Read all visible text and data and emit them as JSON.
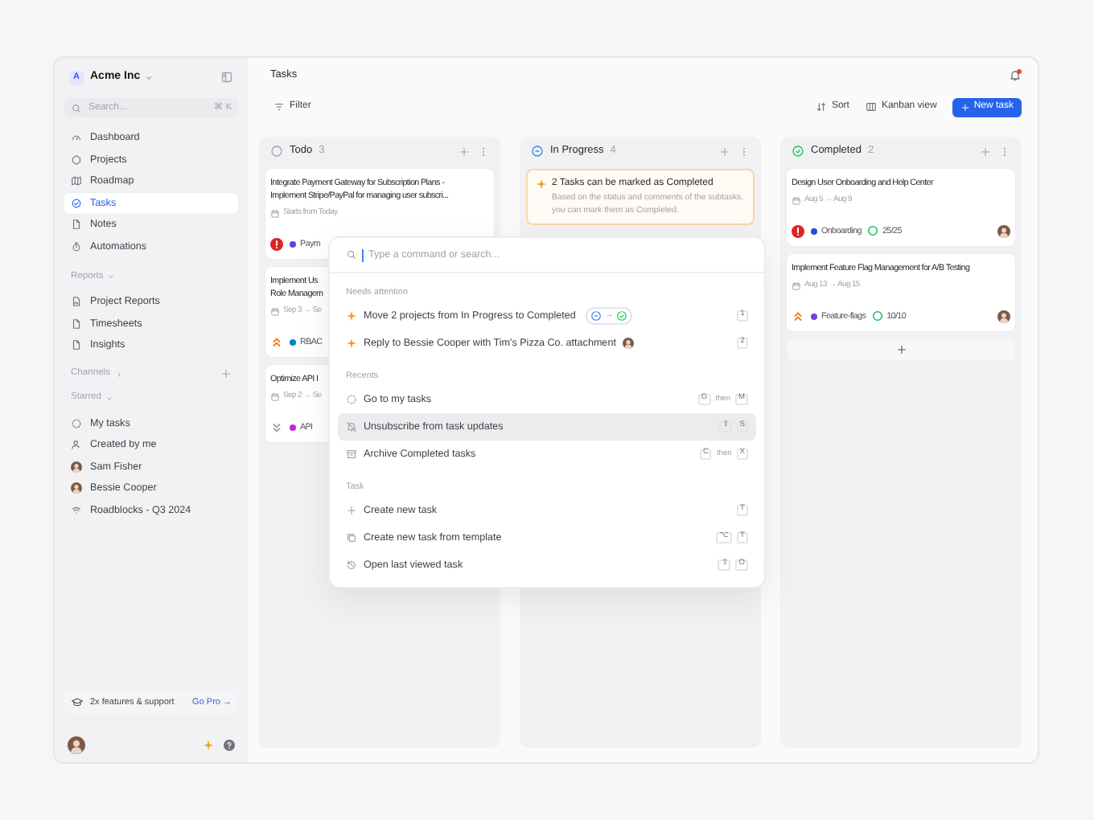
{
  "sidebar": {
    "workspace": {
      "initial": "A",
      "name": "Acme Inc"
    },
    "search": {
      "placeholder": "Search...",
      "shortcut": "⌘ K"
    },
    "nav": [
      {
        "label": "Dashboard",
        "kind": "gauge",
        "selected": false
      },
      {
        "label": "Projects",
        "kind": "hexagon",
        "selected": false
      },
      {
        "label": "Roadmap",
        "kind": "map",
        "selected": false
      },
      {
        "label": "Tasks",
        "kind": "check-circle",
        "selected": true
      },
      {
        "label": "Notes",
        "kind": "file",
        "selected": false
      },
      {
        "label": "Automations",
        "kind": "stopwatch",
        "selected": false
      }
    ],
    "sections": [
      {
        "title": "Reports",
        "expanded": true,
        "items": [
          {
            "label": "Project Reports",
            "kind": "file-chart"
          },
          {
            "label": "Timesheets",
            "kind": "file"
          },
          {
            "label": "Insights",
            "kind": "file"
          }
        ]
      },
      {
        "title": "Channels",
        "expanded": false,
        "addable": true
      },
      {
        "title": "Starred",
        "expanded": true,
        "items": [
          {
            "label": "My tasks",
            "kind": "dashed-circle"
          },
          {
            "label": "Created by me",
            "kind": "user"
          },
          {
            "label": "Sam Fisher",
            "kind": "avatar"
          },
          {
            "label": "Bessie Cooper",
            "kind": "avatar"
          },
          {
            "label": "Roadblocks - Q3 2024",
            "kind": "signal"
          }
        ]
      }
    ],
    "promo": {
      "text": "2x features & support",
      "link": "Go Pro →"
    }
  },
  "header": {
    "title": "Tasks",
    "notification_unread": true
  },
  "toolbar": {
    "filter": "Filter",
    "sort": "Sort",
    "view": "Kanban view",
    "new_task": "New task"
  },
  "columns": [
    {
      "title": "Todo",
      "kind": "todo",
      "count": "3",
      "cards": [
        {
          "title_lines": [
            "Integrate Payment Gateway for Subscription Plans -",
            "Implement Stripe/PayPal for managing user subscri..."
          ],
          "date": "Starts from Today",
          "kind": "urgent",
          "tag": {
            "label": "Paym",
            "color": "#4f46e5"
          }
        },
        {
          "title_lines": [
            "Implement Us",
            "Role Managem"
          ],
          "date": "Sep 3 → Se",
          "kind": "high",
          "tag": {
            "label": "RBAC",
            "color": "#0284c7"
          }
        },
        {
          "title_lines": [
            "Optimize API I"
          ],
          "date": "Sep 2 → Se",
          "kind": "low",
          "tag": {
            "label": "API",
            "color": "#c026d3"
          }
        }
      ]
    },
    {
      "title": "In Progress",
      "kind": "in_progress",
      "count": "4",
      "notice": {
        "title": "2 Tasks can be marked as Completed",
        "text": "Based on the status and comments of the subtasks, you can mark them as Completed."
      }
    },
    {
      "title": "Completed",
      "kind": "completed",
      "count": "2",
      "add_card": true,
      "cards": [
        {
          "title_lines": [
            "Design User Onboarding and Help Center"
          ],
          "date": "Aug 5 → Aug 9",
          "kind": "urgent",
          "tag": {
            "label": "Onboarding",
            "color": "#1d4ed8"
          },
          "progress": {
            "text": "25/25",
            "level": 1
          },
          "avatar": true
        },
        {
          "title_lines": [
            "Implement Feature Flag Management for A/B Testing"
          ],
          "date": "Aug 13 → Aug 15",
          "kind": "high",
          "tag": {
            "label": "Feature-flags",
            "color": "#7c3aed"
          },
          "progress": {
            "text": "10/10",
            "level": 1
          },
          "avatar": true
        }
      ]
    }
  ],
  "palette": {
    "placeholder": "Type a command or search...",
    "groups": [
      {
        "title": "Needs attention",
        "items": [
          {
            "label": "Move 2 projects from In Progress to Completed",
            "kind": "sparkle",
            "selected": false,
            "status_change": {
              "from": {
                "kind": "in_progress"
              },
              "arrow": "→",
              "to": {
                "kind": "completed"
              }
            },
            "shortcut": [
              {
                "kind": "key",
                "text": "1"
              }
            ]
          },
          {
            "label": "Reply to Bessie Cooper with Tim's Pizza Co. attachment",
            "kind": "sparkle",
            "selected": false,
            "avatar": true,
            "shortcut": [
              {
                "kind": "key",
                "text": "2"
              }
            ]
          }
        ]
      },
      {
        "title": "Recents",
        "items": [
          {
            "label": "Go to my tasks",
            "kind": "dashed-circle",
            "selected": false,
            "shortcut": [
              {
                "kind": "key",
                "text": "G"
              },
              {
                "kind": "word",
                "text": "then"
              },
              {
                "kind": "key",
                "text": "M"
              }
            ]
          },
          {
            "label": "Unsubscribe from task updates",
            "kind": "bell-off",
            "selected": true,
            "shortcut": [
              {
                "kind": "key",
                "text": "⇧"
              },
              {
                "kind": "key",
                "text": "S"
              }
            ]
          },
          {
            "label": "Archive Completed tasks",
            "kind": "archive",
            "selected": false,
            "shortcut": [
              {
                "kind": "key",
                "text": "C"
              },
              {
                "kind": "word",
                "text": "then"
              },
              {
                "kind": "key",
                "text": "X"
              }
            ]
          }
        ]
      },
      {
        "title": "Task",
        "items": [
          {
            "label": "Create new task",
            "kind": "plus",
            "selected": false,
            "shortcut": [
              {
                "kind": "key",
                "text": "T"
              }
            ]
          },
          {
            "label": "Create new task from template",
            "kind": "copy",
            "selected": false,
            "shortcut": [
              {
                "kind": "key",
                "text": "⌥"
              },
              {
                "kind": "key",
                "text": "T"
              }
            ]
          },
          {
            "label": "Open last viewed task",
            "kind": "history",
            "selected": false,
            "shortcut": [
              {
                "kind": "key",
                "text": "⇧"
              },
              {
                "kind": "key",
                "text": "O"
              }
            ]
          }
        ]
      }
    ]
  }
}
